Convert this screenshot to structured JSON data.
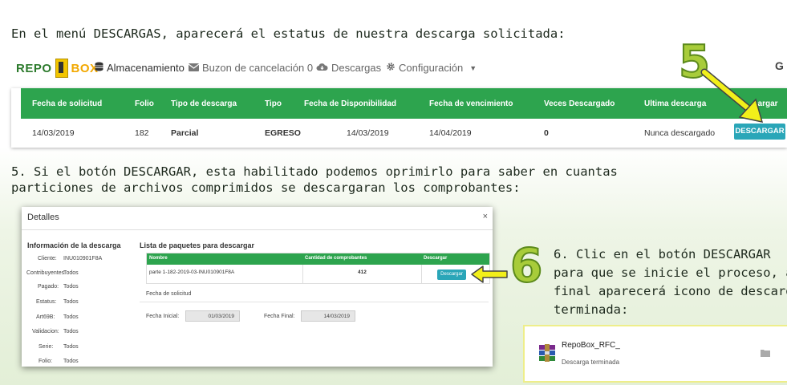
{
  "instructions": {
    "line1": "En el menú DESCARGAS,  aparecerá el estatus de nuestra descarga solicitada:",
    "step5_line1": "5.  Si el botón DESCARGAR, esta habilitado podemos oprimirlo para saber en cuantas",
    "step5_line2": "particiones de archivos comprimidos se descargaran los comprobantes:",
    "step6_line1": "6.  Clic en el botón DESCARGAR",
    "step6_line2": "para que se inicie el proceso, al",
    "step6_line3": "final aparecerá icono de descarga",
    "step6_line4": "terminada:"
  },
  "callouts": {
    "five": "5",
    "six": "6"
  },
  "logo": {
    "part1": "REPO",
    "part2": "BOX"
  },
  "nav": {
    "almacenamiento": "Almacenamiento",
    "buzon": "Buzon de cancelación 0",
    "descargas": "Descargas",
    "configuracion": "Configuración",
    "partial_right": "G"
  },
  "downloads_table": {
    "headers": [
      "Fecha de solicitud",
      "Folio",
      "Tipo de descarga",
      "Tipo",
      "Fecha de Disponibilidad",
      "Fecha de vencimiento",
      "Veces Descargado",
      "Ultima descarga",
      "Descargar"
    ],
    "headers_visible_last": "cargar",
    "row": {
      "fecha_solicitud": "14/03/2019",
      "folio": "182",
      "tipo_descarga": "Parcial",
      "tipo": "EGRESO",
      "fecha_disponibilidad": "14/03/2019",
      "fecha_vencimiento": "14/04/2019",
      "veces": "0",
      "ultima": "Nunca descargado",
      "button": "DESCARGAR"
    }
  },
  "modal": {
    "title": "Detalles",
    "close": "×",
    "info_title": "Información de la descarga",
    "fields": [
      {
        "label": "Cliente:",
        "value": "INU010901F8A"
      },
      {
        "label": "Contribuyentes:",
        "value": "Todos"
      },
      {
        "label": "Pagado:",
        "value": "Todos"
      },
      {
        "label": "Estatus:",
        "value": "Todos"
      },
      {
        "label": "Art69B:",
        "value": "Todos"
      },
      {
        "label": "Validacion:",
        "value": "Todos"
      },
      {
        "label": "Serie:",
        "value": "Todos"
      },
      {
        "label": "Folio:",
        "value": "Todos"
      }
    ],
    "packages_title": "Lista de paquetes para descargar",
    "packages_headers": [
      "Nombre",
      "Cantidad de comprobantes",
      "Descargar"
    ],
    "package_row": {
      "nombre": "parte 1-182-2019-03-INU010901F8A",
      "cantidad": "412",
      "button": "Descargar"
    },
    "fecha_solicitud_label": "Fecha de solicitud",
    "fecha_inicial_label": "Fecha Inicial:",
    "fecha_inicial_value": "01/03/2019",
    "fecha_final_label": "Fecha Final:",
    "fecha_final_value": "14/03/2019"
  },
  "notification": {
    "filename": "RepoBox_RFC_",
    "status": "Descarga terminada"
  },
  "colors": {
    "accent_green": "#2da44e",
    "button_teal": "#2aa6b8",
    "arrow_yellow": "#f2ef1a",
    "callout_green": "#a8cc3a"
  }
}
